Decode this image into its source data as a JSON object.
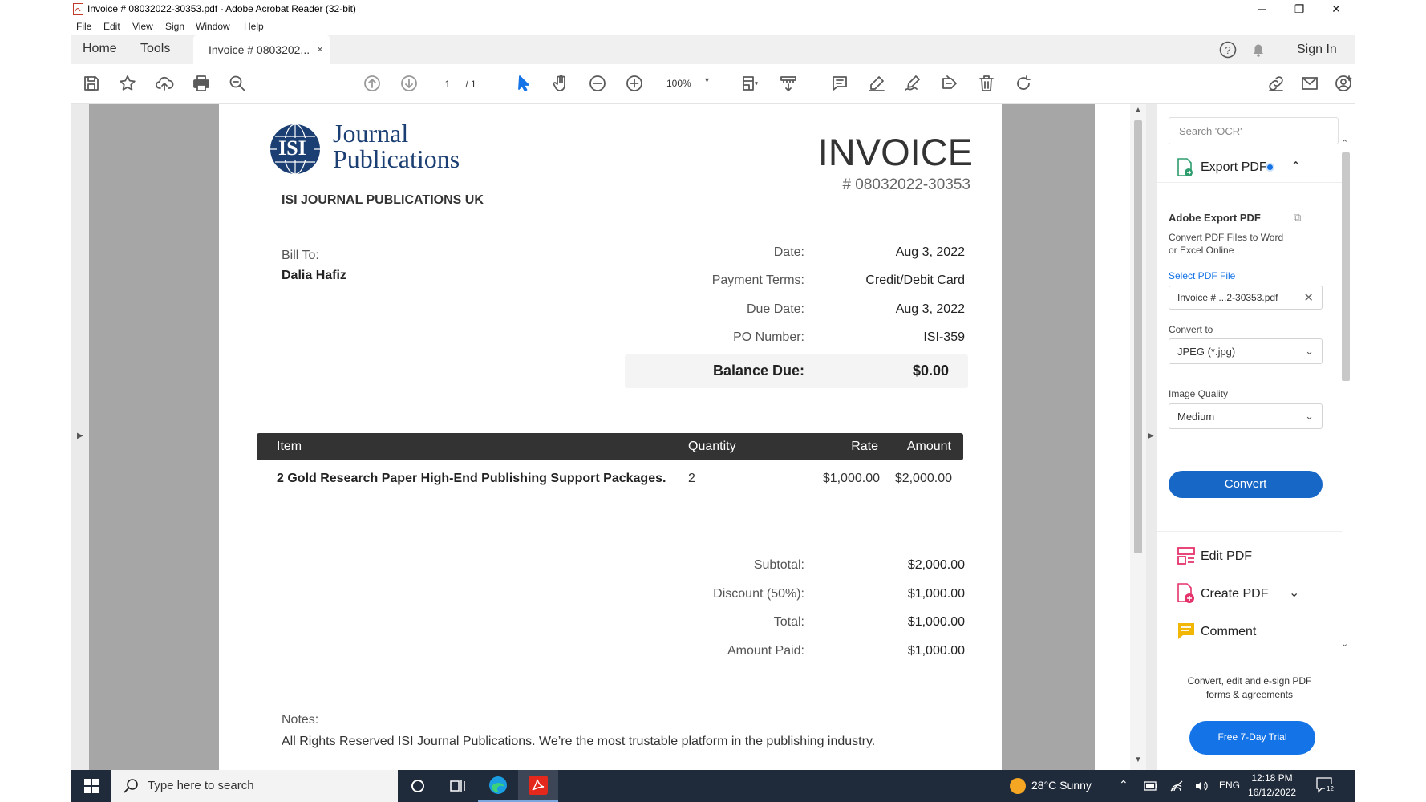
{
  "window": {
    "title": "Invoice # 08032022-30353.pdf - Adobe Acrobat Reader (32-bit)",
    "controls": {
      "minimize": "─",
      "restore": "❐",
      "close": "✕"
    }
  },
  "menu": [
    "File",
    "Edit",
    "View",
    "Sign",
    "Window",
    "Help"
  ],
  "tabs": {
    "home": "Home",
    "tools": "Tools",
    "document": "Invoice # 0803202...",
    "close": "×",
    "signin": "Sign In"
  },
  "toolbar": {
    "page_current": "1",
    "page_total": "/ 1",
    "zoom": "100%"
  },
  "invoice": {
    "logo_line1": "Journal",
    "logo_line2": "Publications",
    "logo_mark": "ISI",
    "company": "ISI JOURNAL PUBLICATIONS UK",
    "heading": "INVOICE",
    "number": "# 08032022-30353",
    "bill_to_label": "Bill To:",
    "bill_to_name": "Dalia Hafiz",
    "fields": [
      {
        "label": "Date:",
        "value": "Aug 3, 2022"
      },
      {
        "label": "Payment Terms:",
        "value": "Credit/Debit Card"
      },
      {
        "label": "Due Date:",
        "value": "Aug 3, 2022"
      },
      {
        "label": "PO Number:",
        "value": "ISI-359"
      }
    ],
    "balance_label": "Balance Due:",
    "balance_value": "$0.00",
    "table_headers": {
      "item": "Item",
      "quantity": "Quantity",
      "rate": "Rate",
      "amount": "Amount"
    },
    "line_items": [
      {
        "item": "2 Gold Research Paper High-End Publishing Support Packages.",
        "quantity": "2",
        "rate": "$1,000.00",
        "amount": "$2,000.00"
      }
    ],
    "totals": [
      {
        "label": "Subtotal:",
        "value": "$2,000.00"
      },
      {
        "label": "Discount (50%):",
        "value": "$1,000.00"
      },
      {
        "label": "Total:",
        "value": "$1,000.00"
      },
      {
        "label": "Amount Paid:",
        "value": "$1,000.00"
      }
    ],
    "notes_label": "Notes:",
    "notes_text": "All Rights Reserved ISI Journal Publications. We’re the most trustable platform in the publishing industry."
  },
  "right_panel": {
    "search_placeholder": "Search 'OCR'",
    "export_title": "Export PDF",
    "adobe_export_title": "Adobe Export PDF",
    "adobe_export_desc": "Convert PDF Files to Word or Excel Online",
    "select_file_link": "Select PDF File",
    "selected_file": "Invoice # ...2-30353.pdf",
    "convert_to_label": "Convert to",
    "convert_to_value": "JPEG (*.jpg)",
    "image_quality_label": "Image Quality",
    "image_quality_value": "Medium",
    "convert_button": "Convert",
    "tools": [
      "Edit PDF",
      "Create PDF",
      "Comment"
    ],
    "promo_text": "Convert, edit and e-sign PDF forms & agreements",
    "trial_button": "Free 7-Day Trial"
  },
  "taskbar": {
    "search_placeholder": "Type here to search",
    "weather": "28°C  Sunny",
    "language": "ENG",
    "time": "12:18 PM",
    "date": "16/12/2022",
    "notification_count": "12"
  },
  "colors": {
    "accent_blue": "#1473e6",
    "taskbar_bg": "#1f2a3a",
    "table_header_bg": "#333333",
    "acrobat_red": "#e4281c"
  }
}
